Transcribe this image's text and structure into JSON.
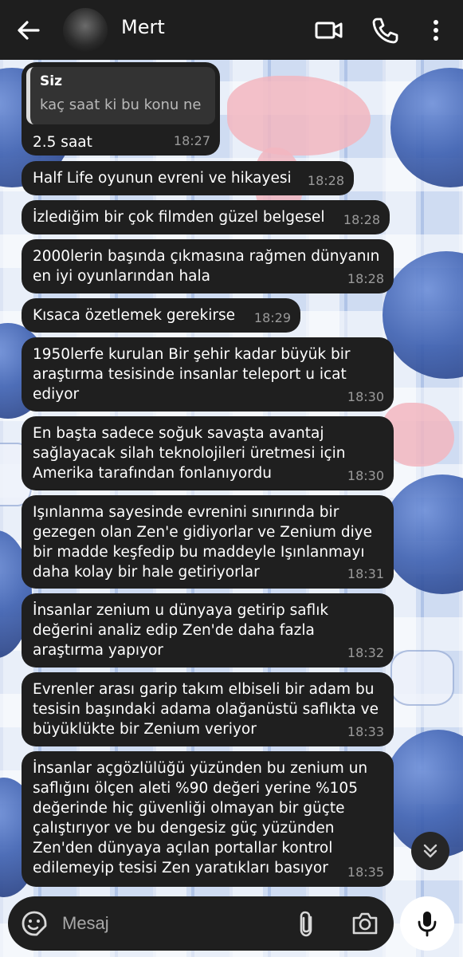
{
  "header": {
    "contact_name": "Mert",
    "back_icon": "arrow-left-icon",
    "video_icon": "video-call-icon",
    "call_icon": "phone-icon",
    "menu_icon": "more-vertical-icon"
  },
  "messages": [
    {
      "quote_author": "Siz",
      "quote_text": "kaç saat ki bu konu ne",
      "text": "2.5 saat",
      "time": "18:27"
    },
    {
      "text": "Half Life oyunun evreni ve hikayesi",
      "time": "18:28"
    },
    {
      "text": "İzlediğim bir çok filmden güzel belgesel",
      "time": "18:28"
    },
    {
      "text": "2000lerin başında çıkmasına rağmen dünyanın\nen iyi oyunlarından hala",
      "time": "18:28"
    },
    {
      "text": "Kısaca özetlemek gerekirse",
      "time": "18:29"
    },
    {
      "text": "1950lerfe kurulan Bir şehir kadar büyük bir\naraştırma tesisinde insanlar teleport u icat\nediyor",
      "time": "18:30"
    },
    {
      "text": "En başta sadece soğuk savaşta avantaj\nsağlayacak silah teknolojileri üretmesi için\nAmerika tarafından fonlanıyordu",
      "time": "18:30"
    },
    {
      "text": "Işınlanma sayesinde evrenini sınırında bir\ngezegen olan Zen'e gidiyorlar ve Zenium diye\nbir madde keşfedip bu maddeyle Işınlanmayı\ndaha kolay bir hale getiriyorlar",
      "time": "18:31"
    },
    {
      "text": "İnsanlar zenium u dünyaya getirip saflık\ndeğerini analiz edip Zen'de daha fazla\naraştırma yapıyor",
      "time": "18:32"
    },
    {
      "text": "Evrenler arası garip takım elbiseli bir adam bu\ntesisin başındaki adama olağanüstü saflıkta ve\nbüyüklükte bir Zenium veriyor",
      "time": "18:33"
    },
    {
      "text": "İnsanlar açgözlülüğü yüzünden bu zenium un\nsaflığını ölçen aleti %90 değeri yerine %105\ndeğerinde hiç güvenliği olmayan bir güçte\nçalıştırıyor ve bu dengesiz güç yüzünden\nZen'den dünyaya açılan portallar kontrol\nedilemeyip tesisi Zen yaratıkları basıyor",
      "time": "18:35"
    }
  ],
  "input": {
    "placeholder": "Mesaj",
    "emoji_icon": "emoji-icon",
    "attach_icon": "paperclip-icon",
    "camera_icon": "camera-icon",
    "mic_icon": "microphone-icon"
  },
  "scroll_down_icon": "double-chevron-down-icon",
  "colors": {
    "bubble": "#1f1f1f",
    "header": "#1e1e1e",
    "time_text": "#9a9a9a"
  }
}
